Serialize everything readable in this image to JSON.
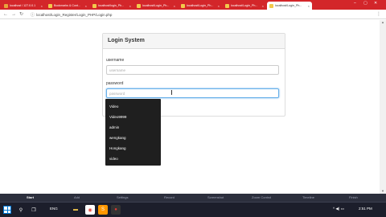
{
  "browser": {
    "tabs": [
      {
        "label": "localhost / 127.0.0.1",
        "fav": "#e8a33c"
      },
      {
        "label": "Bookmarks & Cont...",
        "fav": "#f2c94c"
      },
      {
        "label": "localhost/login_Ph...",
        "fav": "#f2c94c"
      },
      {
        "label": "localhost/Login_Ph...",
        "fav": "#f2c94c"
      },
      {
        "label": "localhost/Login_Ph...",
        "fav": "#f2c94c"
      },
      {
        "label": "localhost/Login_Ph...",
        "fav": "#f2c94c"
      },
      {
        "label": "localhost/Login_Ph...",
        "fav": "#f2c94c",
        "active": true
      }
    ],
    "url": "localhost/Login_Register/Login_PHP/Login.php",
    "close_glyph": "×",
    "nav": {
      "back": "←",
      "forward": "→",
      "reload": "↻"
    },
    "menu_glyph": "⋮",
    "window_controls": {
      "minimize": "–",
      "maximize": "▢",
      "close": "✕"
    }
  },
  "login": {
    "title": "Login System",
    "username_label": "username",
    "username_placeholder": "username",
    "password_label": "password",
    "password_placeholder": "password"
  },
  "autocomplete": {
    "suggestions": [
      "Video",
      "Video9999",
      "admin",
      "wengkang",
      "Hongkang",
      "video"
    ]
  },
  "taskbar": {
    "video_toolbar": [
      "Start",
      "Add",
      "Settings",
      "Record",
      "Screenshot",
      "Zoom Control",
      "Timeline",
      "Finish"
    ],
    "language": "ENG",
    "time": "2:51 PM",
    "icons": [
      {
        "name": "search-icon",
        "glyph": "⚲",
        "color": "#ffffff",
        "bg": "transparent"
      },
      {
        "name": "task-view-icon",
        "glyph": "❐",
        "color": "#ffffff",
        "bg": "transparent"
      },
      {
        "name": "file-explorer-icon",
        "glyph": "▬",
        "color": "#f2c94c",
        "bg": "transparent"
      },
      {
        "name": "chrome-icon",
        "glyph": "◉",
        "color": "#e8453c",
        "bg": "#ffffff"
      },
      {
        "name": "sublime-text-icon",
        "glyph": "S",
        "color": "#ffffff",
        "bg": "#ff9800"
      },
      {
        "name": "recorder-icon",
        "glyph": "●",
        "color": "#e53935",
        "bg": "#333333"
      }
    ]
  }
}
